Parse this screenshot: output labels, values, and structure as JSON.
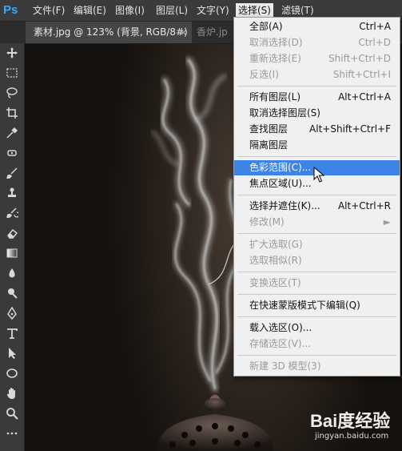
{
  "app": {
    "logo": "Ps"
  },
  "menubar": {
    "items": [
      {
        "label": "文件(F)"
      },
      {
        "label": "编辑(E)"
      },
      {
        "label": "图像(I)"
      },
      {
        "label": "图层(L)"
      },
      {
        "label": "文字(Y)"
      },
      {
        "label": "选择(S)",
        "active": true
      },
      {
        "label": "滤镜(T)"
      }
    ]
  },
  "tabs": {
    "active": {
      "label": "素材.jpg @ 123% (背景, RGB/8#)",
      "close": "×"
    },
    "inactive": {
      "label": "香炉.jp"
    }
  },
  "toolbar": {
    "tools": [
      "move-icon",
      "marquee-icon",
      "lasso-icon",
      "crop-icon",
      "eyedropper-icon",
      "spot-heal-icon",
      "brush-icon",
      "stamp-icon",
      "history-brush-icon",
      "eraser-icon",
      "gradient-icon",
      "blur-icon",
      "dodge-icon",
      "pen-icon",
      "type-icon",
      "path-select-icon",
      "ellipse-icon",
      "hand-icon",
      "zoom-icon",
      "more-icon"
    ]
  },
  "dropdown": {
    "items": [
      {
        "label": "全部(A)",
        "shortcut": "Ctrl+A",
        "enabled": true
      },
      {
        "label": "取消选择(D)",
        "shortcut": "Ctrl+D",
        "enabled": false
      },
      {
        "label": "重新选择(E)",
        "shortcut": "Shift+Ctrl+D",
        "enabled": false
      },
      {
        "label": "反选(I)",
        "shortcut": "Shift+Ctrl+I",
        "enabled": false
      },
      {
        "label": "所有图层(L)",
        "shortcut": "Alt+Ctrl+A",
        "enabled": true
      },
      {
        "label": "取消选择图层(S)",
        "shortcut": "",
        "enabled": true
      },
      {
        "label": "查找图层",
        "shortcut": "Alt+Shift+Ctrl+F",
        "enabled": true
      },
      {
        "label": "隔离图层",
        "shortcut": "",
        "enabled": true
      },
      {
        "label": "色彩范围(C)...",
        "shortcut": "",
        "enabled": true,
        "highlighted": true
      },
      {
        "label": "焦点区域(U)...",
        "shortcut": "",
        "enabled": true
      },
      {
        "label": "选择并遮住(K)...",
        "shortcut": "Alt+Ctrl+R",
        "enabled": true
      },
      {
        "label": "修改(M)",
        "shortcut": "►",
        "enabled": false
      },
      {
        "label": "扩大选取(G)",
        "shortcut": "",
        "enabled": false
      },
      {
        "label": "选取相似(R)",
        "shortcut": "",
        "enabled": false
      },
      {
        "label": "变换选区(T)",
        "shortcut": "",
        "enabled": false
      },
      {
        "label": "在快速蒙版模式下编辑(Q)",
        "shortcut": "",
        "enabled": true
      },
      {
        "label": "载入选区(O)...",
        "shortcut": "",
        "enabled": true
      },
      {
        "label": "存储选区(V)...",
        "shortcut": "",
        "enabled": false
      },
      {
        "label": "新建 3D 模型(3)",
        "shortcut": "",
        "enabled": false
      }
    ]
  },
  "watermark": {
    "logo": "Bai度经验",
    "site": "jingyan.baidu.com"
  }
}
